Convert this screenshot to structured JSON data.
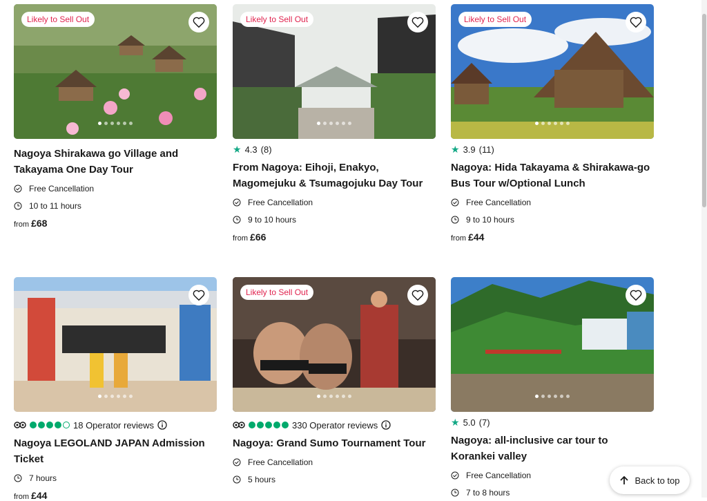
{
  "badge_text": "Likely to Sell Out",
  "cards": [
    {
      "title": "Nagoya Shirakawa go Village and Takayama One Day Tour",
      "rating": "",
      "reviews": "",
      "cancellation": "Free Cancellation",
      "duration": "10 to 11 hours",
      "price_prefix": "from",
      "price": "£68"
    },
    {
      "title": "From Nagoya: Eihoji, Enakyo, Magomejuku & Tsumagojuku Day Tour",
      "rating": "4.3",
      "reviews": "(8)",
      "cancellation": "Free Cancellation",
      "duration": "9 to 10 hours",
      "price_prefix": "from",
      "price": "£66"
    },
    {
      "title": "Nagoya: Hida Takayama & Shirakawa-go Bus Tour w/Optional Lunch",
      "rating": "3.9",
      "reviews": "(11)",
      "cancellation": "Free Cancellation",
      "duration": "9 to 10 hours",
      "price_prefix": "from",
      "price": "£44"
    },
    {
      "title": "Nagoya LEGOLAND JAPAN Admission Ticket",
      "operator_reviews": "18 Operator reviews",
      "bubble_rating": 4,
      "duration": "7 hours",
      "price_prefix": "from",
      "price": "£44"
    },
    {
      "title": "Nagoya: Grand Sumo Tournament Tour",
      "operator_reviews": "330 Operator reviews",
      "bubble_rating": 5,
      "cancellation": "Free Cancellation",
      "duration": "5 hours"
    },
    {
      "title": "Nagoya: all-inclusive car tour to Korankei valley",
      "rating": "5.0",
      "reviews": "(7)",
      "cancellation": "Free Cancellation",
      "duration": "7 to 8 hours"
    }
  ],
  "back_to_top": "Back to top",
  "colors": {
    "badge": "#e0234e",
    "star": "#12a885",
    "bubble": "#00aa6c"
  }
}
